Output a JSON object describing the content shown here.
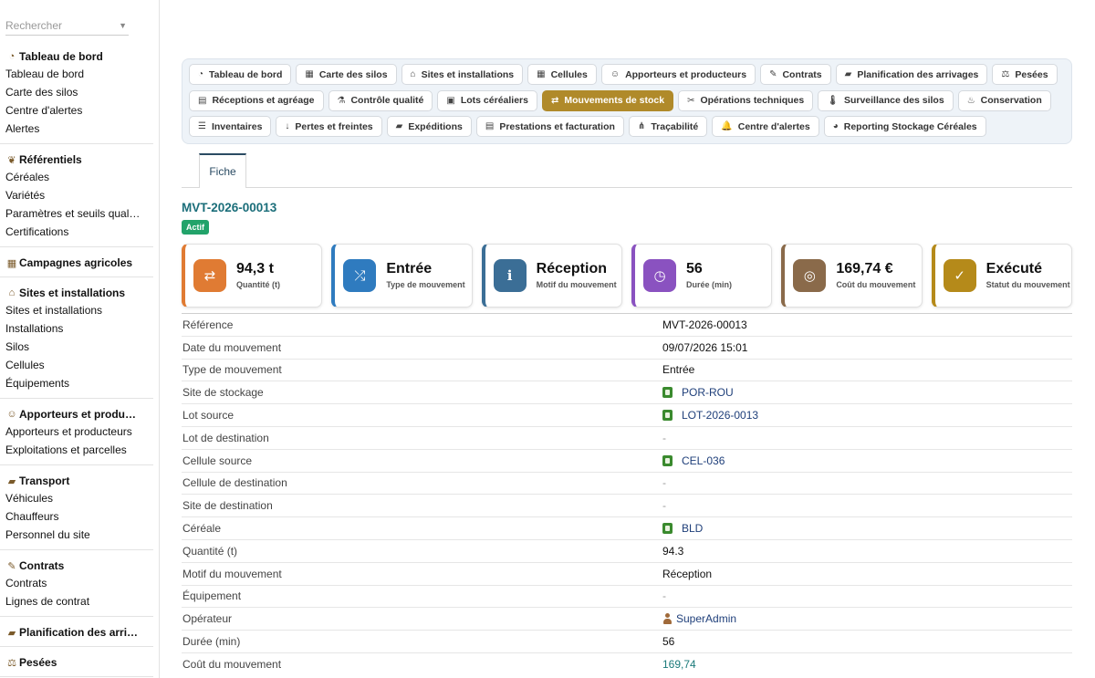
{
  "search": {
    "placeholder": "Rechercher"
  },
  "sidebar": {
    "sections": [
      {
        "title": "Tableau de bord",
        "icon": "gauge-icon",
        "glyph": "◔",
        "items": [
          "Tableau de bord",
          "Carte des silos",
          "Centre d'alertes",
          "Alertes"
        ]
      },
      {
        "title": "Référentiels",
        "icon": "seedling-icon",
        "glyph": "❦",
        "items": [
          "Céréales",
          "Variétés",
          "Paramètres et seuils qual…",
          "Certifications"
        ]
      },
      {
        "title": "Campagnes agricoles",
        "icon": "calendar-icon",
        "glyph": "▦",
        "items": []
      },
      {
        "title": "Sites et installations",
        "icon": "warehouse-icon",
        "glyph": "⌂",
        "items": [
          "Sites et installations",
          "Installations",
          "Silos",
          "Cellules",
          "Équipements"
        ]
      },
      {
        "title": "Apporteurs et produ…",
        "icon": "users-icon",
        "glyph": "☺",
        "items": [
          "Apporteurs et producteurs",
          "Exploitations et parcelles"
        ]
      },
      {
        "title": "Transport",
        "icon": "truck-icon",
        "glyph": "▰",
        "items": [
          "Véhicules",
          "Chauffeurs",
          "Personnel du site"
        ]
      },
      {
        "title": "Contrats",
        "icon": "contract-icon",
        "glyph": "✎",
        "items": [
          "Contrats",
          "Lignes de contrat"
        ]
      },
      {
        "title": "Planification des arri…",
        "icon": "truck-loading-icon",
        "glyph": "▰",
        "items": []
      },
      {
        "title": "Pesées",
        "icon": "scale-icon",
        "glyph": "⚖",
        "items": []
      }
    ]
  },
  "module_tabs": [
    {
      "label": "Tableau de bord",
      "icon": "gauge-icon",
      "glyph": "◔",
      "active": false
    },
    {
      "label": "Carte des silos",
      "icon": "grid-icon",
      "glyph": "▦",
      "active": false
    },
    {
      "label": "Sites et installations",
      "icon": "warehouse-icon",
      "glyph": "⌂",
      "active": false
    },
    {
      "label": "Cellules",
      "icon": "cells-icon",
      "glyph": "▦",
      "active": false
    },
    {
      "label": "Apporteurs et producteurs",
      "icon": "users-icon",
      "glyph": "☺",
      "active": false
    },
    {
      "label": "Contrats",
      "icon": "contract-icon",
      "glyph": "✎",
      "active": false
    },
    {
      "label": "Planification des arrivages",
      "icon": "truck-loading-icon",
      "glyph": "▰",
      "active": false
    },
    {
      "label": "Pesées",
      "icon": "scale-icon",
      "glyph": "⚖",
      "active": false
    },
    {
      "label": "Réceptions et agréage",
      "icon": "clipboard-check-icon",
      "glyph": "▤",
      "active": false
    },
    {
      "label": "Contrôle qualité",
      "icon": "flask-icon",
      "glyph": "⚗",
      "active": false
    },
    {
      "label": "Lots céréaliers",
      "icon": "box-icon",
      "glyph": "▣",
      "active": false
    },
    {
      "label": "Mouvements de stock",
      "icon": "exchange-icon",
      "glyph": "⇄",
      "active": true
    },
    {
      "label": "Opérations techniques",
      "icon": "tools-icon",
      "glyph": "✂",
      "active": false
    },
    {
      "label": "Surveillance des silos",
      "icon": "thermometer-icon",
      "glyph": "🌡",
      "active": false
    },
    {
      "label": "Conservation",
      "icon": "spray-icon",
      "glyph": "♨",
      "active": false
    },
    {
      "label": "Inventaires",
      "icon": "list-icon",
      "glyph": "☰",
      "active": false
    },
    {
      "label": "Pertes et freintes",
      "icon": "arrow-down-icon",
      "glyph": "↓",
      "active": false
    },
    {
      "label": "Expéditions",
      "icon": "truck-icon",
      "glyph": "▰",
      "active": false
    },
    {
      "label": "Prestations et facturation",
      "icon": "invoice-icon",
      "glyph": "▤",
      "active": false
    },
    {
      "label": "Traçabilité",
      "icon": "sitemap-icon",
      "glyph": "⋔",
      "active": false
    },
    {
      "label": "Centre d'alertes",
      "icon": "bell-icon",
      "glyph": "🔔",
      "active": false
    },
    {
      "label": "Reporting Stockage Céréales",
      "icon": "chart-pie-icon",
      "glyph": "◕",
      "active": false
    }
  ],
  "subtab": {
    "label": "Fiche"
  },
  "record": {
    "title": "MVT-2026-00013",
    "status": "Actif",
    "status_color": "#22a36a"
  },
  "kpis": [
    {
      "value": "94,3 t",
      "label": "Quantité (t)",
      "icon": "exchange-icon",
      "glyph": "⇄",
      "color": "#e07b33"
    },
    {
      "value": "Entrée",
      "label": "Type de mouvement",
      "icon": "shuffle-icon",
      "glyph": "⤮",
      "color": "#2f7bbf"
    },
    {
      "value": "Réception",
      "label": "Motif du mouvement",
      "icon": "info-icon",
      "glyph": "ℹ",
      "color": "#3b6e96"
    },
    {
      "value": "56",
      "label": "Durée (min)",
      "icon": "clock-icon",
      "glyph": "◷",
      "color": "#8a52c0"
    },
    {
      "value": "169,74 €",
      "label": "Coût du mouvement",
      "icon": "coins-icon",
      "glyph": "◎",
      "color": "#8a6a4a"
    },
    {
      "value": "Exécuté",
      "label": "Statut du mouvement",
      "icon": "check-circle-icon",
      "glyph": "✓",
      "color": "#b58a1a"
    }
  ],
  "details": [
    {
      "label": "Référence",
      "value": "MVT-2026-00013",
      "type": "text"
    },
    {
      "label": "Date du mouvement",
      "value": "09/07/2026 15:01",
      "type": "text"
    },
    {
      "label": "Type de mouvement",
      "value": "Entrée",
      "type": "text"
    },
    {
      "label": "Site de stockage",
      "value": "POR-ROU",
      "type": "tag"
    },
    {
      "label": "Lot source",
      "value": "LOT-2026-0013",
      "type": "tag"
    },
    {
      "label": "Lot de destination",
      "value": "-",
      "type": "dash"
    },
    {
      "label": "Cellule source",
      "value": "CEL-036",
      "type": "tag"
    },
    {
      "label": "Cellule de destination",
      "value": "-",
      "type": "dash"
    },
    {
      "label": "Site de destination",
      "value": "-",
      "type": "dash"
    },
    {
      "label": "Céréale",
      "value": "BLD",
      "type": "tag"
    },
    {
      "label": "Quantité (t)",
      "value": "94.3",
      "type": "text"
    },
    {
      "label": "Motif du mouvement",
      "value": "Réception",
      "type": "text"
    },
    {
      "label": "Équipement",
      "value": "-",
      "type": "dash"
    },
    {
      "label": "Opérateur",
      "value": "SuperAdmin",
      "type": "user"
    },
    {
      "label": "Durée (min)",
      "value": "56",
      "type": "text"
    },
    {
      "label": "Coût du mouvement",
      "value": "169,74",
      "type": "money"
    }
  ]
}
